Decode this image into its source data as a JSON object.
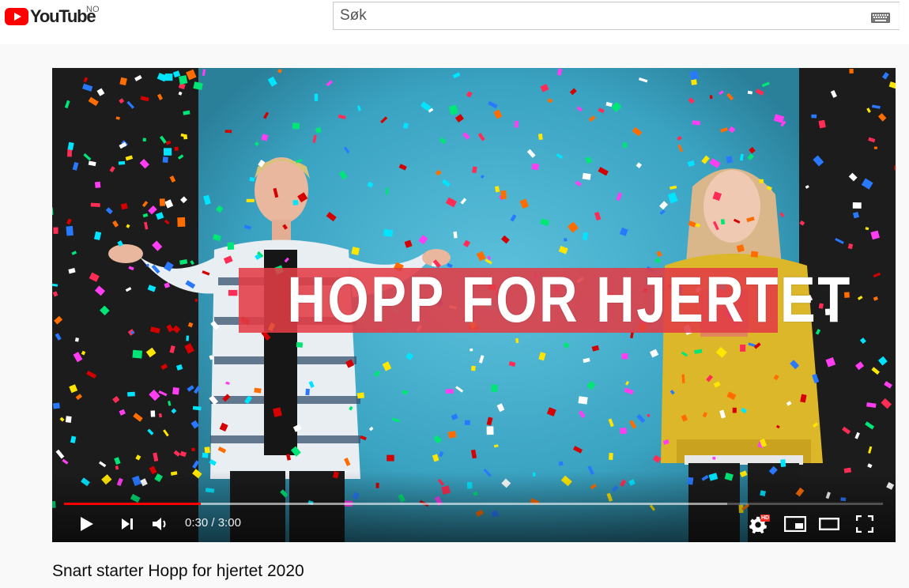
{
  "brand": {
    "name": "YouTube",
    "region": "NO",
    "color": "#ff0000"
  },
  "search": {
    "placeholder": "Søk",
    "keyboard_icon": "keyboard-icon"
  },
  "player": {
    "title_overlay": "HOPP FOR HJERTET",
    "time_current": "0:30",
    "time_separator": " / ",
    "time_total": "3:00",
    "progress_played": 0.1667,
    "progress_buffered": 0.81,
    "quality_badge": "HD",
    "colors": {
      "progress": "#ff0000",
      "banner": "#e23c46",
      "background": "#3aa3c2"
    },
    "controls": {
      "play": "play-icon",
      "next": "next-icon",
      "volume": "volume-icon",
      "settings": "gear-icon",
      "miniplayer": "miniplayer-icon",
      "theater": "theater-icon",
      "fullscreen": "fullscreen-icon"
    }
  },
  "video": {
    "title": "Snart starter Hopp for hjertet 2020"
  }
}
